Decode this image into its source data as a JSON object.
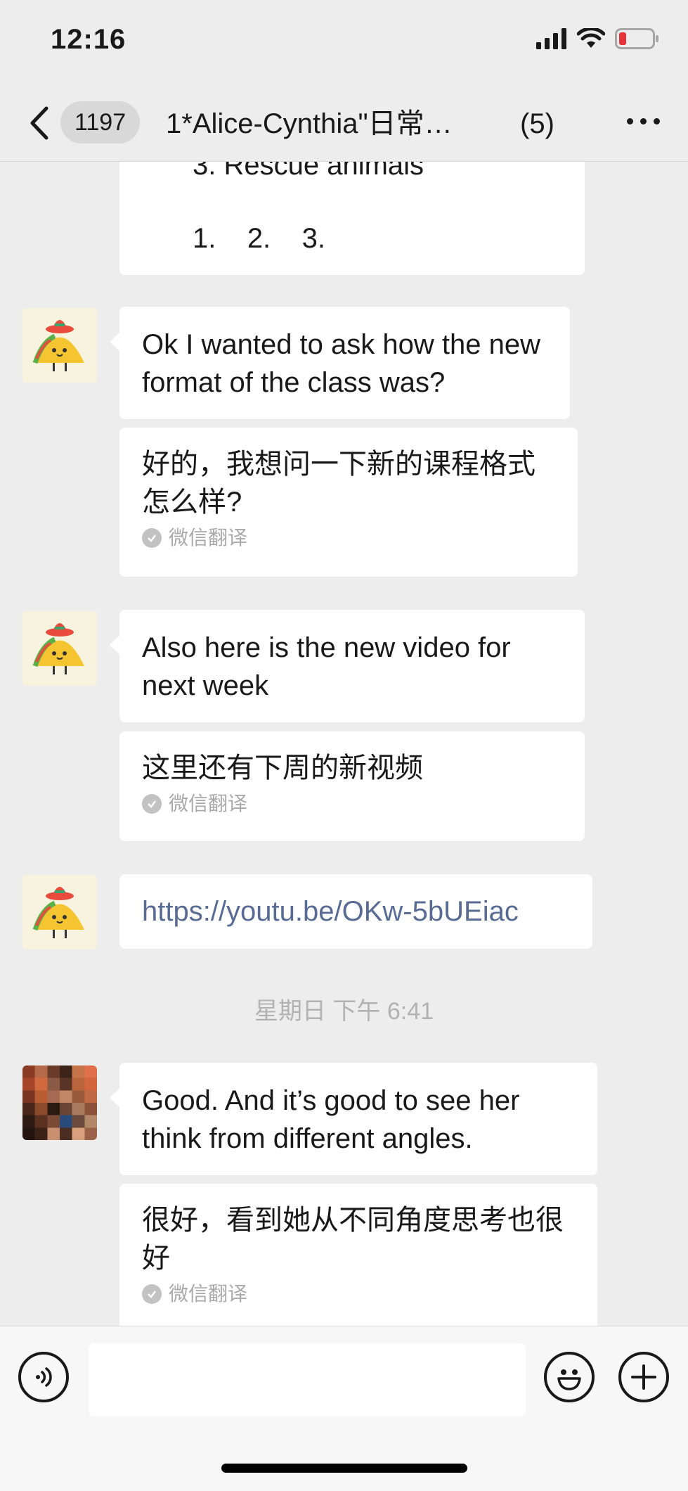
{
  "status": {
    "time": "12:16"
  },
  "nav": {
    "unread_count": "1197",
    "title": "1*Alice-Cynthia\"日常…",
    "member_count": "(5)"
  },
  "messages": {
    "list_partial_item": "3.   Rescue animals",
    "list_numbers": "1.    2.    3.",
    "msg1_text": "Ok I wanted to ask how the new format of the class was?",
    "msg1_translation": "好的，我想问一下新的课程格式怎么样?",
    "msg2_text": "Also here is the new video for next week",
    "msg2_translation": "这里还有下周的新视频",
    "msg3_link": "https://youtu.be/OKw-5bUEiac",
    "timestamp": "星期日 下午 6:41",
    "msg4_text": "Good. And it’s good to see her think from different angles.",
    "msg4_translation": "很好，看到她从不同角度思考也很好",
    "translation_label": "微信翻译"
  },
  "input": {
    "value": ""
  },
  "colors": {
    "background": "#ededed",
    "bubble": "#ffffff",
    "link": "#576b95",
    "meta": "#a9a9a9"
  },
  "icons": [
    "back-chevron-icon",
    "more-icon",
    "voice-icon",
    "emoji-icon",
    "add-icon",
    "check-icon",
    "signal-icon",
    "wifi-icon",
    "battery-icon"
  ]
}
